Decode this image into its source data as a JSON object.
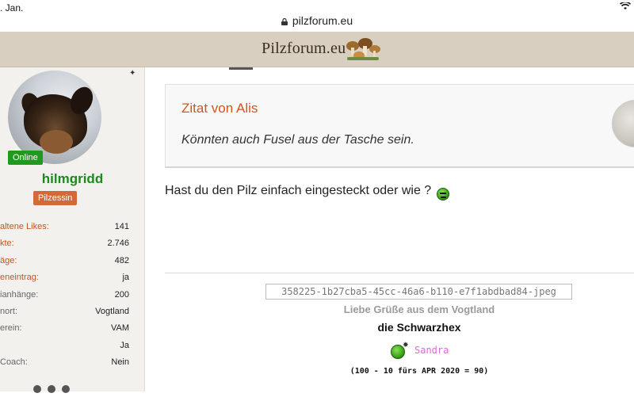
{
  "status": {
    "date": ". Jan."
  },
  "browser": {
    "url": "pilzforum.eu"
  },
  "header": {
    "brand": "Pilzforum.eu"
  },
  "sidebar": {
    "online_label": "Online",
    "username": "hilmgridd",
    "rank": "Pilzessin",
    "stats": [
      {
        "label": "altene Likes:",
        "value": "141",
        "accent": true
      },
      {
        "label": "kte:",
        "value": "2.746",
        "accent": true
      },
      {
        "label": "äge:",
        "value": "482",
        "accent": true
      },
      {
        "label": "eneintrag:",
        "value": "ja",
        "accent": true
      },
      {
        "label": "ianhänge:",
        "value": "200",
        "accent": false
      },
      {
        "label": "nort:",
        "value": "Vogtland",
        "accent": false
      },
      {
        "label": "erein:",
        "value": "VAM",
        "accent": false
      },
      {
        "label": "",
        "value": "Ja",
        "accent": false
      },
      {
        "label": "Coach:",
        "value": "Nein",
        "accent": false
      }
    ]
  },
  "post": {
    "quote_author": "Zitat von Alis",
    "quote_text": "Könnten auch Fusel aus der Tasche sein.",
    "body": "Hast du den Pilz einfach eingesteckt oder wie ?",
    "smiley_icon": "green-smiley-icon"
  },
  "signature": {
    "image_alt": "358225-1b27cba5-45cc-46a6-b110-e7f1abdbad84-jpeg",
    "greeting": "Liebe Grüße aus dem Vogtland",
    "name": "die Schwarzhex",
    "sandra": "Sandra",
    "count": "(100 - 10 fürs APR 2020 = 90)"
  },
  "colors": {
    "header_bg": "#d9cfc1",
    "accent_orange": "#d4541c",
    "online_green": "#1f9a1f",
    "username_green": "#1d8a1d",
    "rank_orange": "#d2693a",
    "sandra_pink": "#e066d8"
  }
}
